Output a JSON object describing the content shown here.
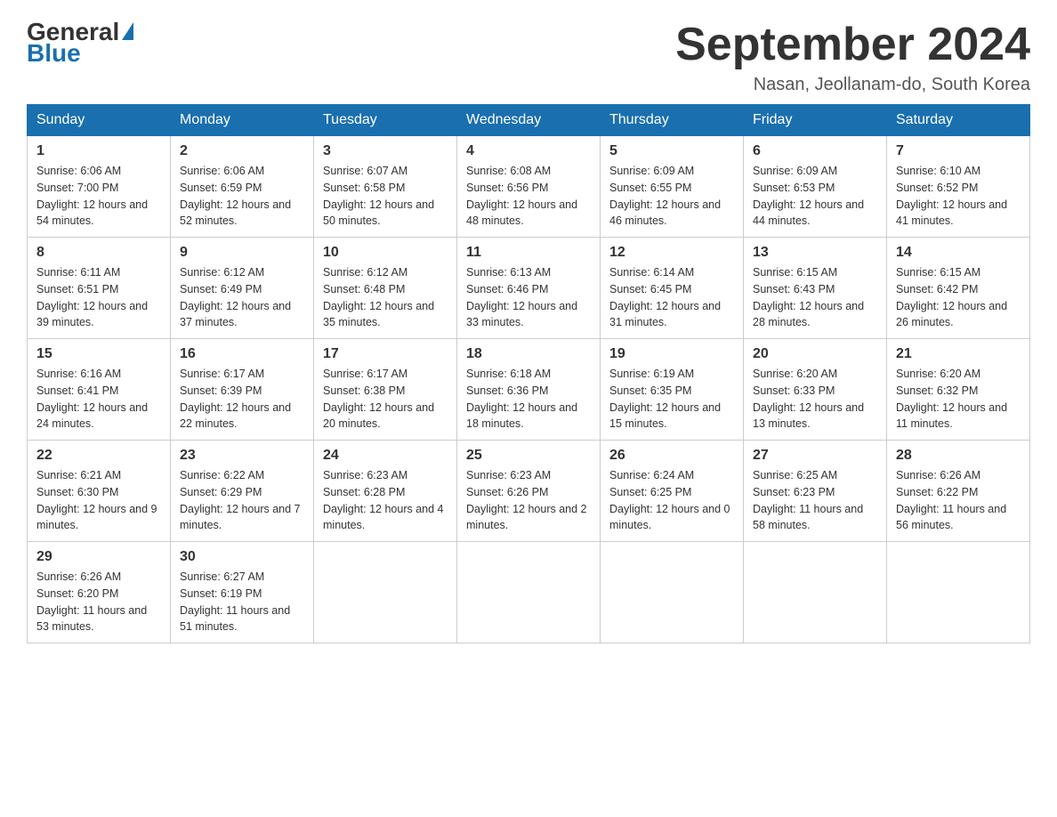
{
  "logo": {
    "text_general": "General",
    "text_blue": "Blue",
    "triangle": "▶"
  },
  "header": {
    "title": "September 2024",
    "subtitle": "Nasan, Jeollanam-do, South Korea"
  },
  "weekdays": [
    "Sunday",
    "Monday",
    "Tuesday",
    "Wednesday",
    "Thursday",
    "Friday",
    "Saturday"
  ],
  "weeks": [
    [
      {
        "day": "1",
        "sunrise": "6:06 AM",
        "sunset": "7:00 PM",
        "daylight": "12 hours and 54 minutes."
      },
      {
        "day": "2",
        "sunrise": "6:06 AM",
        "sunset": "6:59 PM",
        "daylight": "12 hours and 52 minutes."
      },
      {
        "day": "3",
        "sunrise": "6:07 AM",
        "sunset": "6:58 PM",
        "daylight": "12 hours and 50 minutes."
      },
      {
        "day": "4",
        "sunrise": "6:08 AM",
        "sunset": "6:56 PM",
        "daylight": "12 hours and 48 minutes."
      },
      {
        "day": "5",
        "sunrise": "6:09 AM",
        "sunset": "6:55 PM",
        "daylight": "12 hours and 46 minutes."
      },
      {
        "day": "6",
        "sunrise": "6:09 AM",
        "sunset": "6:53 PM",
        "daylight": "12 hours and 44 minutes."
      },
      {
        "day": "7",
        "sunrise": "6:10 AM",
        "sunset": "6:52 PM",
        "daylight": "12 hours and 41 minutes."
      }
    ],
    [
      {
        "day": "8",
        "sunrise": "6:11 AM",
        "sunset": "6:51 PM",
        "daylight": "12 hours and 39 minutes."
      },
      {
        "day": "9",
        "sunrise": "6:12 AM",
        "sunset": "6:49 PM",
        "daylight": "12 hours and 37 minutes."
      },
      {
        "day": "10",
        "sunrise": "6:12 AM",
        "sunset": "6:48 PM",
        "daylight": "12 hours and 35 minutes."
      },
      {
        "day": "11",
        "sunrise": "6:13 AM",
        "sunset": "6:46 PM",
        "daylight": "12 hours and 33 minutes."
      },
      {
        "day": "12",
        "sunrise": "6:14 AM",
        "sunset": "6:45 PM",
        "daylight": "12 hours and 31 minutes."
      },
      {
        "day": "13",
        "sunrise": "6:15 AM",
        "sunset": "6:43 PM",
        "daylight": "12 hours and 28 minutes."
      },
      {
        "day": "14",
        "sunrise": "6:15 AM",
        "sunset": "6:42 PM",
        "daylight": "12 hours and 26 minutes."
      }
    ],
    [
      {
        "day": "15",
        "sunrise": "6:16 AM",
        "sunset": "6:41 PM",
        "daylight": "12 hours and 24 minutes."
      },
      {
        "day": "16",
        "sunrise": "6:17 AM",
        "sunset": "6:39 PM",
        "daylight": "12 hours and 22 minutes."
      },
      {
        "day": "17",
        "sunrise": "6:17 AM",
        "sunset": "6:38 PM",
        "daylight": "12 hours and 20 minutes."
      },
      {
        "day": "18",
        "sunrise": "6:18 AM",
        "sunset": "6:36 PM",
        "daylight": "12 hours and 18 minutes."
      },
      {
        "day": "19",
        "sunrise": "6:19 AM",
        "sunset": "6:35 PM",
        "daylight": "12 hours and 15 minutes."
      },
      {
        "day": "20",
        "sunrise": "6:20 AM",
        "sunset": "6:33 PM",
        "daylight": "12 hours and 13 minutes."
      },
      {
        "day": "21",
        "sunrise": "6:20 AM",
        "sunset": "6:32 PM",
        "daylight": "12 hours and 11 minutes."
      }
    ],
    [
      {
        "day": "22",
        "sunrise": "6:21 AM",
        "sunset": "6:30 PM",
        "daylight": "12 hours and 9 minutes."
      },
      {
        "day": "23",
        "sunrise": "6:22 AM",
        "sunset": "6:29 PM",
        "daylight": "12 hours and 7 minutes."
      },
      {
        "day": "24",
        "sunrise": "6:23 AM",
        "sunset": "6:28 PM",
        "daylight": "12 hours and 4 minutes."
      },
      {
        "day": "25",
        "sunrise": "6:23 AM",
        "sunset": "6:26 PM",
        "daylight": "12 hours and 2 minutes."
      },
      {
        "day": "26",
        "sunrise": "6:24 AM",
        "sunset": "6:25 PM",
        "daylight": "12 hours and 0 minutes."
      },
      {
        "day": "27",
        "sunrise": "6:25 AM",
        "sunset": "6:23 PM",
        "daylight": "11 hours and 58 minutes."
      },
      {
        "day": "28",
        "sunrise": "6:26 AM",
        "sunset": "6:22 PM",
        "daylight": "11 hours and 56 minutes."
      }
    ],
    [
      {
        "day": "29",
        "sunrise": "6:26 AM",
        "sunset": "6:20 PM",
        "daylight": "11 hours and 53 minutes."
      },
      {
        "day": "30",
        "sunrise": "6:27 AM",
        "sunset": "6:19 PM",
        "daylight": "11 hours and 51 minutes."
      },
      null,
      null,
      null,
      null,
      null
    ]
  ]
}
